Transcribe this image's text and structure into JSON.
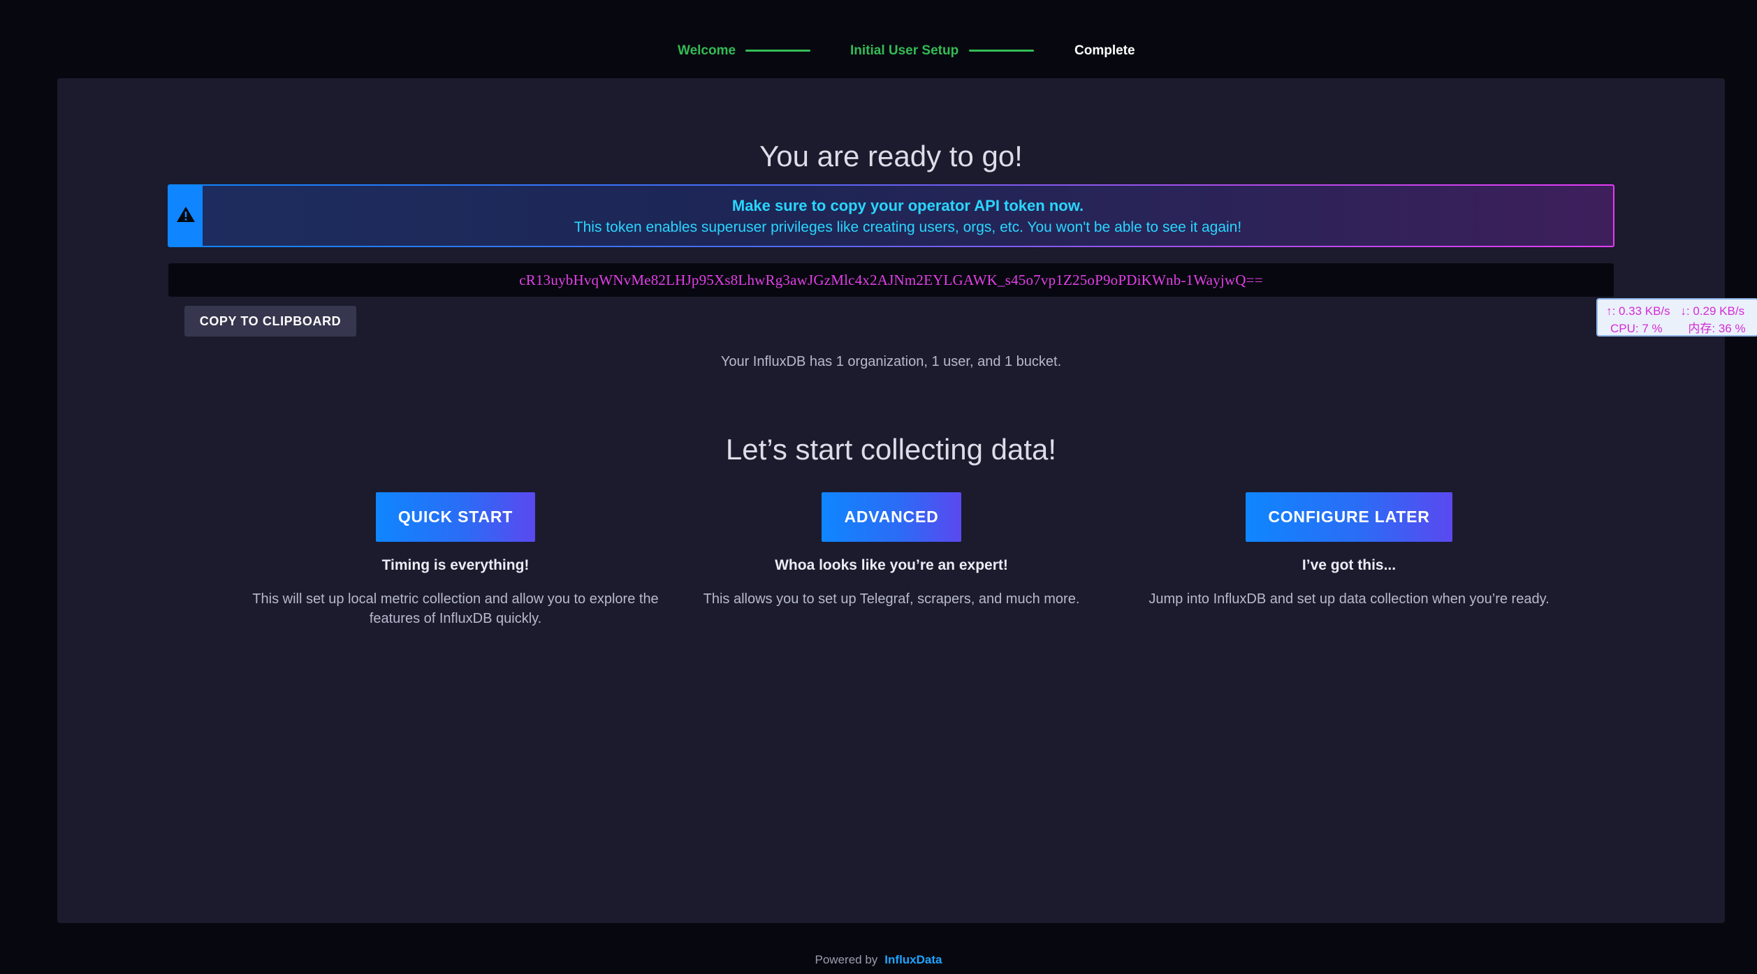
{
  "stepper": {
    "steps": [
      {
        "label": "Welcome"
      },
      {
        "label": "Initial User Setup"
      },
      {
        "label": "Complete"
      }
    ]
  },
  "main": {
    "title": "You are ready to go!",
    "alert": {
      "icon": "warning-triangle-icon",
      "title": "Make sure to copy your operator API token now.",
      "text": "This token enables superuser privileges like creating users, orgs, etc. You won't be able to see it again!"
    },
    "token": "cR13uybHvqWNvMe82LHJp95Xs8LhwRg3awJGzMlc4x2AJNm2EYLGAWK_s45o7vp1Z25oP9oPDiKWnb-1WayjwQ==",
    "copy_button": "COPY TO CLIPBOARD",
    "summary": "Your InfluxDB has 1 organization, 1 user, and 1 bucket.",
    "collect_title": "Let’s start collecting data!",
    "options": [
      {
        "button": "QUICK START",
        "heading": "Timing is everything!",
        "description": "This will set up local metric collection and allow you to explore the features of InfluxDB quickly."
      },
      {
        "button": "ADVANCED",
        "heading": "Whoa looks like you’re an expert!",
        "description": "This allows you to set up Telegraf, scrapers, and much more."
      },
      {
        "button": "CONFIGURE LATER",
        "heading": "I’ve got this...",
        "description": "Jump into InfluxDB and set up data collection when you’re ready."
      }
    ]
  },
  "footer": {
    "powered_by": "Powered by",
    "brand": "InfluxData"
  },
  "netmon": {
    "upload": "↑: 0.33 KB/s",
    "download": "↓: 0.29 KB/s",
    "cpu": "CPU: 7 %",
    "memory": "内存: 36 %"
  },
  "colors": {
    "background": "#07080f",
    "panel": "#1b1b2d",
    "step_done": "#34bb55",
    "accent_blue": "#0f86ff",
    "alert_text": "#29d6ff",
    "token_text": "#e33fe8"
  }
}
